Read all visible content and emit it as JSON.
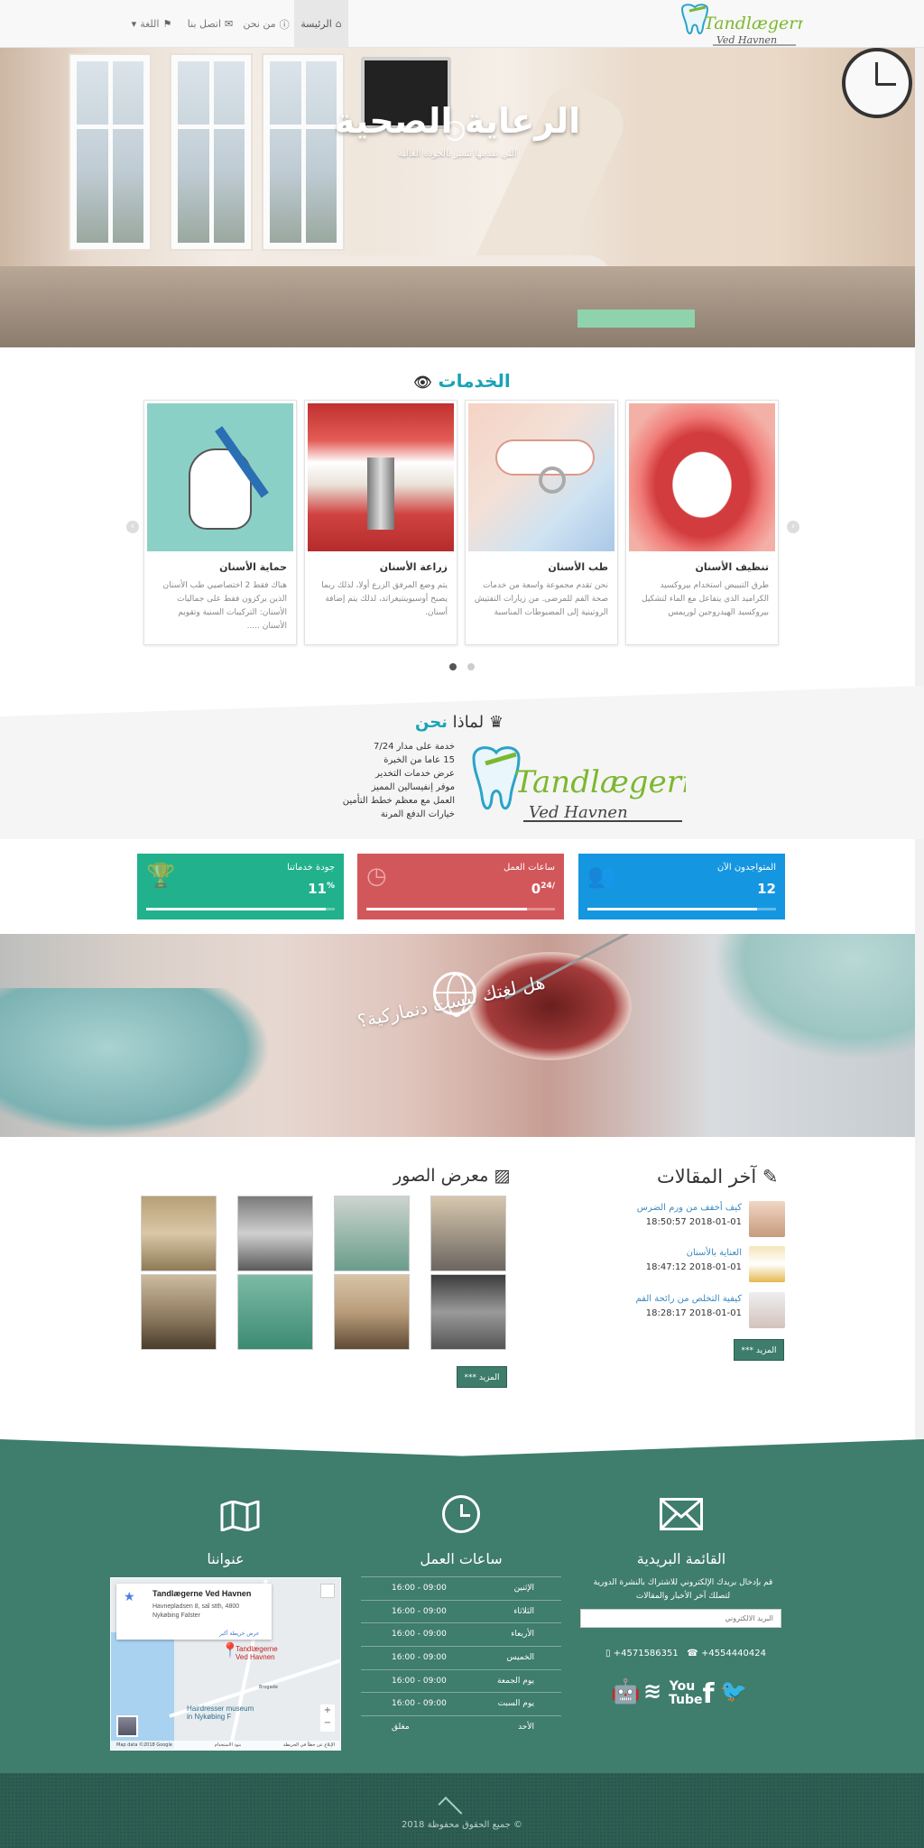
{
  "header": {
    "brand": "Tandlægerne",
    "brand_sub": "Ved Havnen",
    "nav": {
      "home": "الرئيسة",
      "about": "من نحن",
      "contact": "اتصل بنا",
      "language": "اللغة"
    }
  },
  "hero": {
    "title": "الرعاية الصحية",
    "subtitle": "التي نقدمها تتميز بالجودة العالية"
  },
  "services": {
    "title": "الخدمات",
    "cards": [
      {
        "title": "تنظيف الأسنان",
        "text": "طرق التبييض استخدام بيروكسيد الكراميد الذي يتفاعل مع الماء لتشكيل بيروكسيد الهيدروجين لوريمس"
      },
      {
        "title": "طب الأسنان",
        "text": "نحن تقدم مجموعة واسعة من خدمات صحة الفم للمرضى. من زيارات التفتيش الروتينية إلى المضبوطات المناسبة"
      },
      {
        "title": "زراعة الأسنان",
        "text": "يتم وضع المرفق الزرع أولا، لذلك ربما يصبح أوسيوينتيغراتد، لذلك يتم إضافة أسنان."
      },
      {
        "title": "حماية الأسنان",
        "text": "هناك فقط 2 اختصاصيي طب الأسنان الذين يركزون فقط على جماليات الأسنان: التركيبات السنية وتقويم الأسنان ....."
      }
    ]
  },
  "why": {
    "title_prefix": "لماذا",
    "title_accent": "نحن",
    "items": [
      "خدمة على مدار 7/24",
      "15 عاما من الخبرة",
      "عرض خدمات التخدير",
      "موفر إنفيسالين المميز",
      "العمل مع معظم خطط التأمين",
      "خيارات الدفع المرنة"
    ]
  },
  "stats": [
    {
      "label": "المتواجدون الآن",
      "value": "12",
      "color": "#1596e0",
      "icon": "users-icon",
      "fill": 0.9
    },
    {
      "label": "ساعات العمل",
      "value": "0",
      "sup": "24/",
      "color": "#d2575a",
      "icon": "clock-icon",
      "fill": 0.85
    },
    {
      "label": "جودة خدماتنا",
      "value": "11",
      "sup": "%",
      "color": "#21b18d",
      "icon": "trophy-icon",
      "fill": 0.95
    }
  ],
  "banner": {
    "text": "هل لغتك ليست دنماركية؟"
  },
  "gallery": {
    "title": "معرض الصور",
    "more": "*** المزيد"
  },
  "articles": {
    "title": "آخر المقالات",
    "items": [
      {
        "title": "كيف أخفف من ورم الضرس",
        "date": "2018-01-01 18:50:57"
      },
      {
        "title": "العناية بالأسنان",
        "date": "2018-01-01 18:47:12"
      },
      {
        "title": "كيفية التخلص من رائحة الفم",
        "date": "2018-01-01 18:28:17"
      }
    ],
    "more": "*** المزيد"
  },
  "footer": {
    "newsletter_title": "القائمة البريدية",
    "newsletter_text": "قم بإدخال بريدك الإلكتروني للاشتراك بالنشرة الدورية لتصلك آخر الأخبار والمقالات",
    "email_placeholder": "البريد الالكتروني",
    "phone1": "+4571586351",
    "phone2": "+4554440424",
    "hours_title": "ساعات العمل",
    "hours": [
      {
        "day": "الإثنين",
        "time": "09:00 - 16:00"
      },
      {
        "day": "الثلاثاء",
        "time": "09:00 - 16:00"
      },
      {
        "day": "الأربعاء",
        "time": "09:00 - 16:00"
      },
      {
        "day": "الخميس",
        "time": "09:00 - 16:00"
      },
      {
        "day": "يوم الجمعة",
        "time": "09:00 - 16:00"
      },
      {
        "day": "يوم السبت",
        "time": "09:00 - 16:00"
      },
      {
        "day": "الأحد",
        "time": "مغلق"
      }
    ],
    "address_title": "عنواننا",
    "map": {
      "name": "Tandlægerne Ved Havnen",
      "address1": "Havnepladsen 8, sal stth, 4800",
      "address2": "Nykøbing Falster",
      "link": "عرض خريطة أكبر",
      "pin_label1": "Tandlægerne",
      "pin_label2": "Ved Havnen",
      "poi1": "Hairdresser museum",
      "poi2": "in Nykøbing F",
      "road": "Brogade",
      "attribution": "Map data ©2018 Google",
      "terms": "بنود الاستخدام",
      "report": "الإبلاغ عن خطأ في الخريطة"
    },
    "copyright": "© جميع الحقوق محفوظة 2018"
  },
  "colors": {
    "teal": "#3f7d6c",
    "accent": "#1aa3b5",
    "brand_green": "#7cb82f"
  }
}
